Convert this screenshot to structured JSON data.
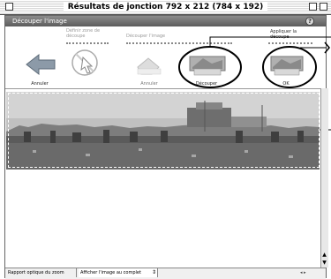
{
  "window": {
    "title": "Résultats de jonction 792 x 212 (784 x 192)"
  },
  "panel": {
    "title": "Découper l'image",
    "info": "?"
  },
  "toolbar": {
    "step1_caption": "Définir zone de découpe",
    "step2_caption": "Découper l'image",
    "step3_caption": "Appliquer la découpe",
    "btn_undo1": "Annuler",
    "btn_undo2": "Annuler",
    "btn_crop": "Découper",
    "btn_ok": "OK"
  },
  "statusbar": {
    "zoom_label": "Rapport optique du zoom",
    "display_select": "Afficher l'image au complet"
  }
}
